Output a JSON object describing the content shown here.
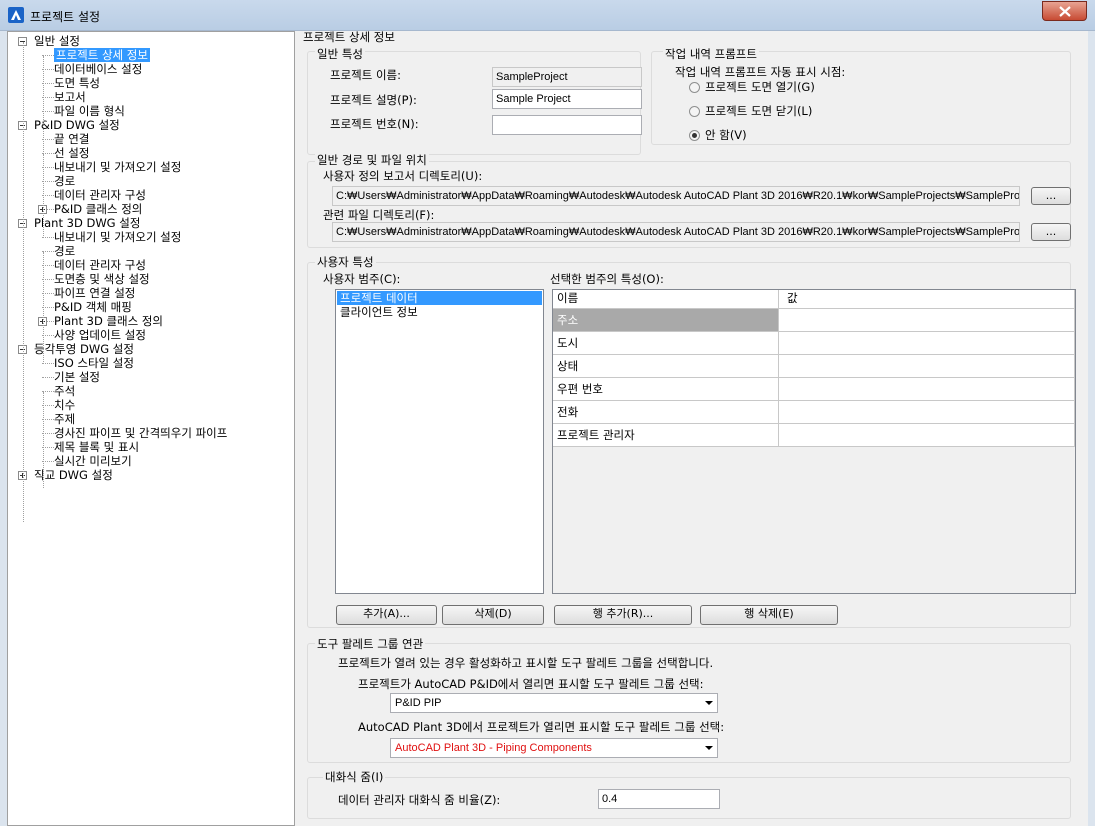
{
  "window": {
    "title": "프로젝트 설정"
  },
  "tree": [
    {
      "label": "일반 설정",
      "level": 0,
      "expander": "minus"
    },
    {
      "label": "프로젝트 상세 정보",
      "level": 1,
      "selected": true
    },
    {
      "label": "데이터베이스 설정",
      "level": 1
    },
    {
      "label": "도면 특성",
      "level": 1
    },
    {
      "label": "보고서",
      "level": 1
    },
    {
      "label": "파일 이름 형식",
      "level": 1
    },
    {
      "label": "P&ID DWG 설정",
      "level": 0,
      "expander": "minus"
    },
    {
      "label": "끝 연결",
      "level": 1
    },
    {
      "label": "선 설정",
      "level": 1
    },
    {
      "label": "내보내기 및 가져오기 설정",
      "level": 1
    },
    {
      "label": "경로",
      "level": 1
    },
    {
      "label": "데이터 관리자 구성",
      "level": 1
    },
    {
      "label": "P&ID 클래스 정의",
      "level": 1,
      "expander": "plus"
    },
    {
      "label": "Plant 3D DWG 설정",
      "level": 0,
      "expander": "minus"
    },
    {
      "label": "내보내기 및 가져오기 설정",
      "level": 1
    },
    {
      "label": "경로",
      "level": 1
    },
    {
      "label": "데이터 관리자 구성",
      "level": 1
    },
    {
      "label": "도면층 및 색상 설정",
      "level": 1
    },
    {
      "label": "파이프 연결 설정",
      "level": 1
    },
    {
      "label": "P&ID 객체 매핑",
      "level": 1
    },
    {
      "label": "Plant 3D 클래스 정의",
      "level": 1,
      "expander": "plus"
    },
    {
      "label": "사양 업데이트 설정",
      "level": 1
    },
    {
      "label": "등각투영 DWG 설정",
      "level": 0,
      "expander": "minus"
    },
    {
      "label": "ISO 스타일 설정",
      "level": 1
    },
    {
      "label": "기본 설정",
      "level": 1
    },
    {
      "label": "주석",
      "level": 1
    },
    {
      "label": "치수",
      "level": 1
    },
    {
      "label": "주제",
      "level": 1
    },
    {
      "label": "경사진 파이프 및 간격띄우기 파이프",
      "level": 1
    },
    {
      "label": "제목 블록 및 표시",
      "level": 1
    },
    {
      "label": "실시간 미리보기",
      "level": 1
    },
    {
      "label": "직교 DWG 설정",
      "level": 0,
      "expander": "plus"
    }
  ],
  "section_title": "프로젝트 상세 정보",
  "general": {
    "title": "일반 특성",
    "name_label": "프로젝트 이름:",
    "name_value": "SampleProject",
    "desc_label": "프로젝트 설명(P):",
    "desc_value": "Sample Project",
    "number_label": "프로젝트 번호(N):",
    "number_value": ""
  },
  "prompt": {
    "title": "작업 내역 프롬프트",
    "caption": "작업 내역 프롬프트 자동 표시 시점:",
    "options": [
      {
        "label": "프로젝트 도면 열기(G)",
        "checked": false
      },
      {
        "label": "프로젝트 도면 닫기(L)",
        "checked": false
      },
      {
        "label": "안 함(V)",
        "checked": true
      }
    ]
  },
  "paths": {
    "title": "일반 경로 및 파일 위치",
    "report_label": "사용자 정의 보고서 디렉토리(U):",
    "report_value": "C:₩Users₩Administrator₩AppData₩Roaming₩Autodesk₩Autodesk AutoCAD Plant 3D 2016₩R20.1₩kor₩SampleProjects₩SampleProjec",
    "related_label": "관련 파일 디렉토리(F):",
    "related_value": "C:₩Users₩Administrator₩AppData₩Roaming₩Autodesk₩Autodesk AutoCAD Plant 3D 2016₩R20.1₩kor₩SampleProjects₩SampleProjec",
    "browse_label": "..."
  },
  "user_props": {
    "title": "사용자 특성",
    "categories_label": "사용자 범주(C):",
    "categories": [
      {
        "label": "프로젝트 데이터",
        "selected": true
      },
      {
        "label": "클라이언트 정보",
        "selected": false
      }
    ],
    "props_label": "선택한 범주의 특성(O):",
    "col_name": "이름",
    "col_value": "값",
    "rows": [
      {
        "name": "주소",
        "value": "",
        "highlight": true
      },
      {
        "name": "도시",
        "value": ""
      },
      {
        "name": "상태",
        "value": ""
      },
      {
        "name": "우편 번호",
        "value": ""
      },
      {
        "name": "전화",
        "value": ""
      },
      {
        "name": "프로젝트 관리자",
        "value": ""
      }
    ],
    "add_label": "추가(A)...",
    "delete_label": "삭제(D)",
    "add_row_label": "행 추가(R)...",
    "delete_row_label": "행 삭제(E)"
  },
  "palette": {
    "title": "도구 팔레트 그룹 연관",
    "description": "프로젝트가 열려 있는 경우 활성화하고 표시할 도구 팔레트 그룹을 선택합니다.",
    "pid_label": "프로젝트가 AutoCAD P&ID에서 열리면 표시할 도구 팔레트 그룹 선택:",
    "pid_value": "P&ID PIP",
    "plant_label": "AutoCAD Plant 3D에서 프로젝트가 열리면 표시할 도구 팔레트 그룹 선택:",
    "plant_value": "AutoCAD Plant 3D - Piping Components",
    "plant_color": "#e01010"
  },
  "zoom": {
    "title": "대화식 줌(I)",
    "label": "데이터 관리자 대화식 줌 비율(Z):",
    "value": "0.4"
  }
}
